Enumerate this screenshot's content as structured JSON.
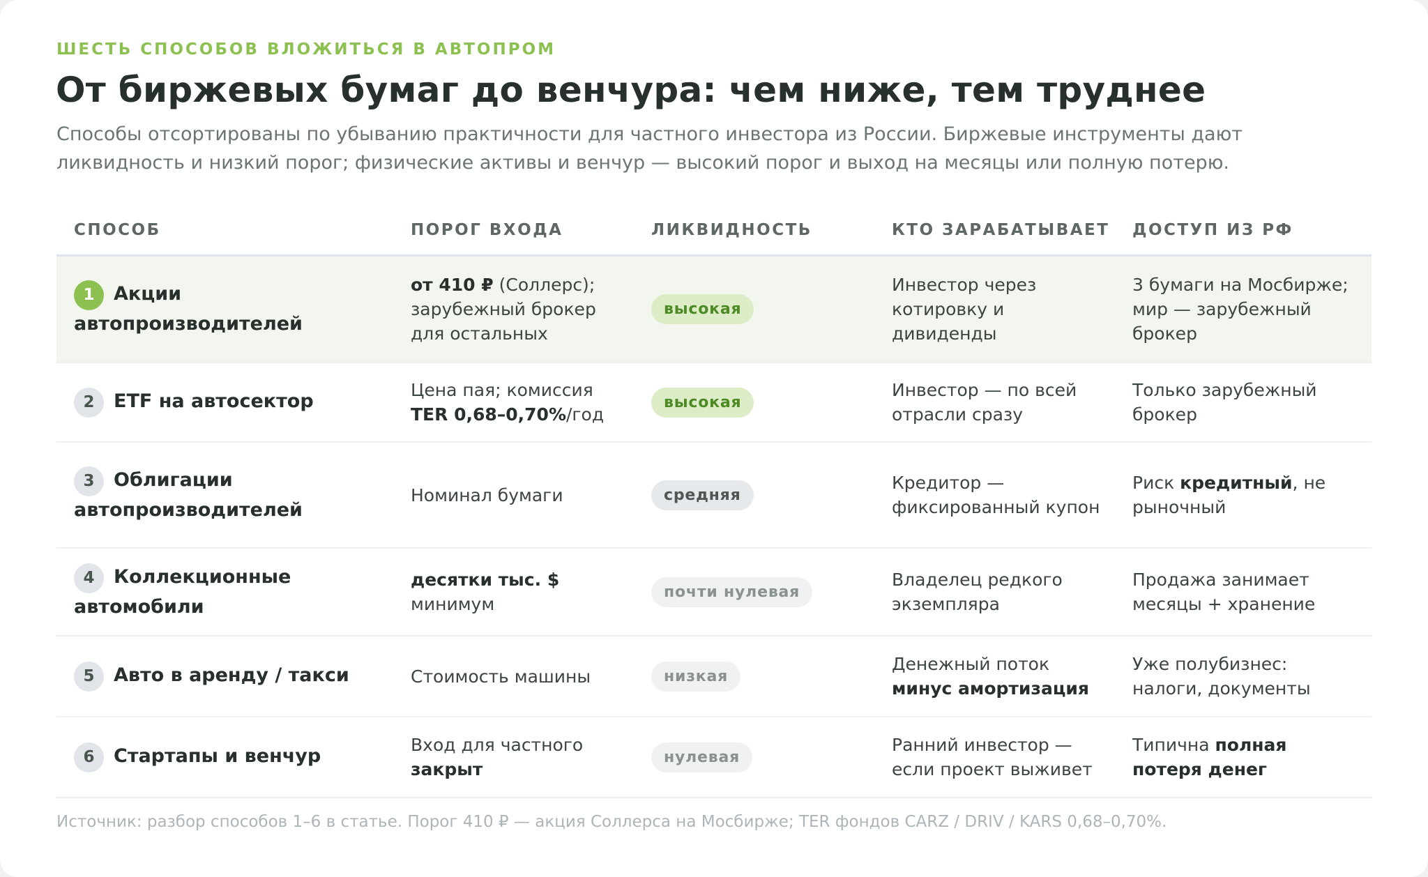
{
  "kicker": "ШЕСТЬ СПОСОБОВ ВЛОЖИТЬСЯ В АВТОПРОМ",
  "title": "От биржевых бумаг до венчура: чем ниже, тем труднее",
  "subtitle": "Способы отсортированы по убыванию практичности для частного инвестора из России. Биржевые инструменты дают ликвидность и низкий порог; физические активы и венчур — высокий порог и выход на месяцы или полную потерю.",
  "columns": [
    "СПОСОБ",
    "ПОРОГ ВХОДА",
    "ЛИКВИДНОСТЬ",
    "КТО ЗАРАБАТЫВАЕТ",
    "ДОСТУП ИЗ РФ"
  ],
  "rows": [
    {
      "num": "1",
      "method": "Акции автопроизводителей",
      "entry": [
        {
          "text": "от 410 ₽",
          "bold": true
        },
        {
          "text": " (Соллерс); зарубежный брокер для остальных",
          "bold": false
        }
      ],
      "liquidity": "высокая",
      "liquidity_level": "high",
      "earns": [
        {
          "text": "Инвестор через котировку и дивиденды",
          "bold": false
        }
      ],
      "access": [
        {
          "text": "3 бумаги на Мосбирже; мир — зарубежный брокер",
          "bold": false
        }
      ]
    },
    {
      "num": "2",
      "method": "ETF на автосектор",
      "entry": [
        {
          "text": "Цена пая; комиссия ",
          "bold": false
        },
        {
          "text": "TER 0,68–0,70%",
          "bold": true
        },
        {
          "text": "/год",
          "bold": false
        }
      ],
      "liquidity": "высокая",
      "liquidity_level": "high",
      "earns": [
        {
          "text": "Инвестор — по всей отрасли сразу",
          "bold": false
        }
      ],
      "access": [
        {
          "text": "Только зарубежный брокер",
          "bold": false
        }
      ]
    },
    {
      "num": "3",
      "method": "Облигации автопроизводителей",
      "entry": [
        {
          "text": "Номинал бумаги",
          "bold": false
        }
      ],
      "liquidity": "средняя",
      "liquidity_level": "medium",
      "earns": [
        {
          "text": "Кредитор — фиксированный купон",
          "bold": false
        }
      ],
      "access": [
        {
          "text": "Риск ",
          "bold": false
        },
        {
          "text": "кредитный",
          "bold": true
        },
        {
          "text": ", не рыночный",
          "bold": false
        }
      ]
    },
    {
      "num": "4",
      "method": "Коллекционные автомобили",
      "entry": [
        {
          "text": "десятки тыс. $",
          "bold": true
        },
        {
          "text": " минимум",
          "bold": false
        }
      ],
      "liquidity": "почти нулевая",
      "liquidity_level": "low",
      "earns": [
        {
          "text": "Владелец редкого экземпляра",
          "bold": false
        }
      ],
      "access": [
        {
          "text": "Продажа занимает месяцы + хранение",
          "bold": false
        }
      ]
    },
    {
      "num": "5",
      "method": "Авто в аренду / такси",
      "entry": [
        {
          "text": "Стоимость машины",
          "bold": false
        }
      ],
      "liquidity": "низкая",
      "liquidity_level": "low",
      "earns": [
        {
          "text": "Денежный поток ",
          "bold": false
        },
        {
          "text": "минус амортизация",
          "bold": true
        }
      ],
      "access": [
        {
          "text": "Уже полубизнес: налоги, документы",
          "bold": false
        }
      ]
    },
    {
      "num": "6",
      "method": "Стартапы и венчур",
      "entry": [
        {
          "text": "Вход для частного ",
          "bold": false
        },
        {
          "text": "закрыт",
          "bold": true
        }
      ],
      "liquidity": "нулевая",
      "liquidity_level": "low",
      "earns": [
        {
          "text": "Ранний инвестор — если проект выживет",
          "bold": false
        }
      ],
      "access": [
        {
          "text": "Типична ",
          "bold": false
        },
        {
          "text": "полная потеря денег",
          "bold": true
        }
      ]
    }
  ],
  "highlighted_row": 0,
  "source": "Источник: разбор способов 1–6 в статье. Порог 410 ₽ — акция Соллерса на Мосбирже; TER фондов CARZ / DRIV / KARS 0,68–0,70%.",
  "colors": {
    "accent": "#8cc152",
    "highlight_row_bg": "#f3f6ee",
    "pill_high_bg": "#dcecc6",
    "pill_high_text": "#4d8a24"
  }
}
